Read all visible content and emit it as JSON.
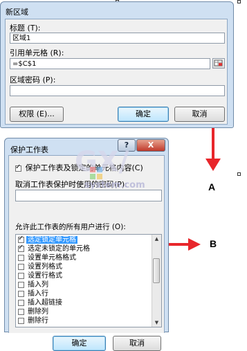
{
  "region_dialog": {
    "title": "新区域",
    "title_label": "标题 (T):",
    "title_value": "区域1",
    "refers_label": "引用单元格 (R):",
    "refers_value": "=$C$1",
    "password_label": "区域密码 (P):",
    "password_value": "",
    "permissions_button": "权限 (E)...",
    "ok_button": "确定",
    "cancel_button": "取消"
  },
  "protect_dialog": {
    "title": "保护工作表",
    "help_button": "?",
    "close_button": "X",
    "protect_checkbox_label": "保护工作表及锁定的单元格内容(C)",
    "protect_checked": true,
    "unprotect_password_label": "取消工作表保护时使用的密码(P):",
    "unprotect_password_value": "",
    "allow_label": "允许此工作表的所有用户进行 (O):",
    "permissions": [
      {
        "label": "选定锁定单元格",
        "checked": true,
        "selected": true
      },
      {
        "label": "选定未锁定的单元格",
        "checked": true,
        "selected": false
      },
      {
        "label": "设置单元格格式",
        "checked": false,
        "selected": false
      },
      {
        "label": "设置列格式",
        "checked": false,
        "selected": false
      },
      {
        "label": "设置行格式",
        "checked": false,
        "selected": false
      },
      {
        "label": "插入列",
        "checked": false,
        "selected": false
      },
      {
        "label": "插入行",
        "checked": false,
        "selected": false
      },
      {
        "label": "插入超链接",
        "checked": false,
        "selected": false
      },
      {
        "label": "删除列",
        "checked": false,
        "selected": false
      },
      {
        "label": "删除行",
        "checked": false,
        "selected": false
      }
    ],
    "ok_button": "确定",
    "cancel_button": "取消"
  },
  "annotations": {
    "arrow_a_label": "A",
    "arrow_b_label": "B",
    "arrow_color": "#e8262b"
  },
  "watermark": {
    "text_big": "GX/",
    "text_small": "system.com"
  }
}
